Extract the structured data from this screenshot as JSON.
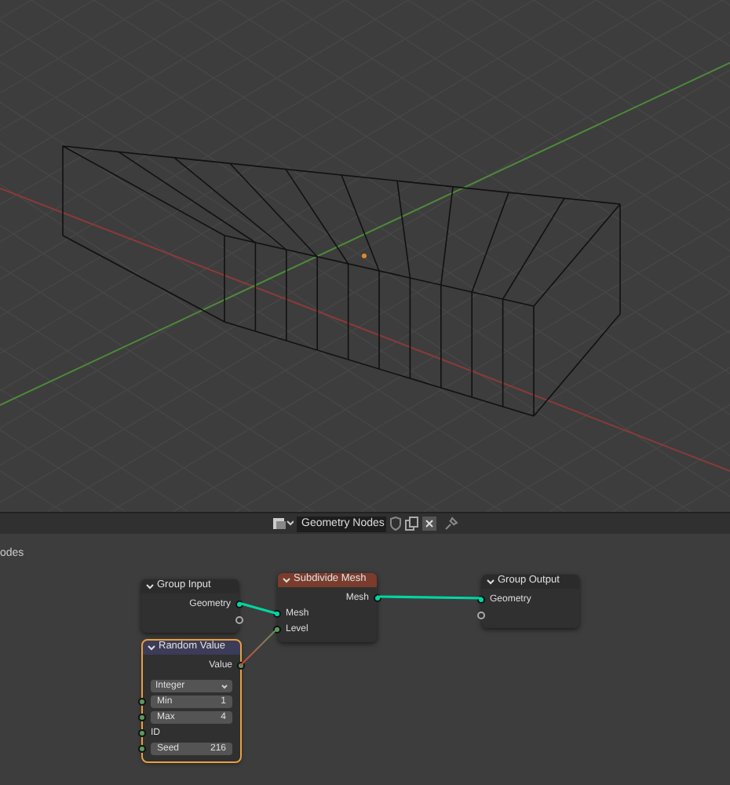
{
  "viewport": {
    "kind": "wireframe"
  },
  "editor_header": {
    "node_group_name": "Geometry Nodes"
  },
  "breadcrumb": "odes",
  "nodes": [
    {
      "title": "Group Input",
      "color": "#2b2b2b",
      "selected": false,
      "rows": [
        {
          "kind": "output",
          "label": "Geometry",
          "color": "#00d6a3"
        },
        {
          "kind": "output-empty"
        }
      ]
    },
    {
      "title": "Subdivide Mesh",
      "color": "#7a3c2c",
      "selected": false,
      "rows": [
        {
          "kind": "output",
          "label": "Mesh",
          "color": "#00d6a3"
        },
        {
          "kind": "input",
          "label": "Mesh",
          "color": "#00d6a3"
        },
        {
          "kind": "input",
          "label": "Level",
          "color": "#5a9a5e"
        }
      ]
    },
    {
      "title": "Group Output",
      "color": "#2b2b2b",
      "selected": false,
      "rows": [
        {
          "kind": "input",
          "label": "Geometry",
          "color": "#00d6a3"
        },
        {
          "kind": "input-empty"
        }
      ]
    },
    {
      "title": "Random Value",
      "color": "#3c3c58",
      "selected": true,
      "rows": [
        {
          "kind": "output",
          "label": "Value",
          "color": "#5a9a5e"
        },
        {
          "kind": "dropdown",
          "value": "Integer"
        },
        {
          "kind": "field",
          "label": "Min",
          "value": "1",
          "color": "#5a9a5e"
        },
        {
          "kind": "field",
          "label": "Max",
          "value": "4",
          "color": "#5a9a5e"
        },
        {
          "kind": "input",
          "label": "ID",
          "color": "#5a9a5e"
        },
        {
          "kind": "field",
          "label": "Seed",
          "value": "216",
          "color": "#5a9a5e"
        }
      ]
    }
  ],
  "links": [
    {
      "kind": "geometry"
    },
    {
      "kind": "geometry"
    },
    {
      "kind": "value"
    }
  ]
}
